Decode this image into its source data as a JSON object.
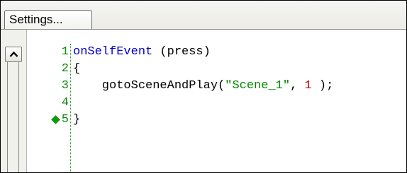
{
  "toolbar": {
    "settings_label": "Settings..."
  },
  "editor": {
    "lines": [
      {
        "num": "1",
        "parts": [
          {
            "t": "onSelfEvent",
            "c": "kw"
          },
          {
            "t": " (press)",
            "c": ""
          }
        ]
      },
      {
        "num": "2",
        "parts": [
          {
            "t": "{",
            "c": ""
          }
        ]
      },
      {
        "num": "3",
        "parts": [
          {
            "t": "    gotoSceneAndPlay(",
            "c": ""
          },
          {
            "t": "\"Scene_1\"",
            "c": "str"
          },
          {
            "t": ", ",
            "c": ""
          },
          {
            "t": "1",
            "c": "num"
          },
          {
            "t": " );",
            "c": ""
          }
        ]
      },
      {
        "num": "4",
        "parts": []
      },
      {
        "num": "5",
        "parts": [
          {
            "t": "}",
            "c": ""
          }
        ],
        "marker": "green-diamond"
      }
    ]
  },
  "colors": {
    "keyword": "#0000cc",
    "string": "#008800",
    "number": "#cc0000",
    "line_number": "#0a8a0a"
  },
  "icons": {
    "scroll_up": "chevron-up-icon",
    "marker": "green-diamond-icon"
  }
}
